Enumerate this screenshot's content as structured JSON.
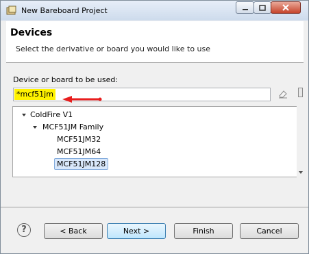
{
  "window": {
    "title": "New Bareboard Project"
  },
  "header": {
    "title": "Devices",
    "description": "Select the derivative or board you would like to use"
  },
  "device_field": {
    "label": "Device or board to be used:",
    "value": "*mcf51jm"
  },
  "tree": {
    "items": [
      {
        "label": "ColdFire V1",
        "level": 0,
        "expanded": true
      },
      {
        "label": "MCF51JM Family",
        "level": 1,
        "expanded": true
      },
      {
        "label": "MCF51JM32",
        "level": 2
      },
      {
        "label": "MCF51JM64",
        "level": 2
      },
      {
        "label": "MCF51JM128",
        "level": 2,
        "selected": true
      }
    ]
  },
  "footer": {
    "help_icon": "?",
    "back_label": "< Back",
    "next_label": "Next >",
    "finish_label": "Finish",
    "cancel_label": "Cancel"
  },
  "colors": {
    "highlight": "#fff200",
    "arrow": "#e81e1e",
    "selection": "#d9e8fb"
  }
}
